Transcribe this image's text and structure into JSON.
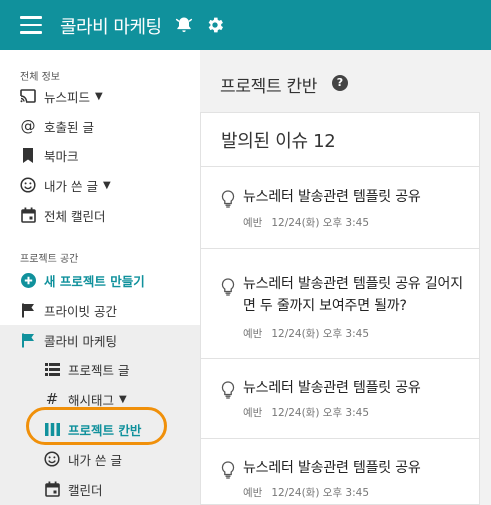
{
  "header": {
    "menu_icon": "hamburger-icon",
    "title": "콜라비 마케팅",
    "notification_icon": "bell-icon",
    "settings_icon": "gear-icon",
    "bg_color": "#10919c"
  },
  "sidebar": {
    "section_all": "전체 정보",
    "newsfeed": "뉴스피드",
    "mentions": "호출된 글",
    "bookmarks": "북마크",
    "my_posts": "내가 쓴 글",
    "all_calendar": "전체 캘린더",
    "section_projects": "프로젝트 공간",
    "new_project": "새 프로젝트 만들기",
    "private_space": "프라이빗 공간",
    "project_name": "콜라비 마케팅",
    "sub_project_posts": "프로젝트 글",
    "sub_hashtags": "해시태그",
    "sub_kanban": "프로젝트 칸반",
    "sub_my_posts": "내가 쓴 글",
    "sub_calendar": "캘린더"
  },
  "main": {
    "page_title": "프로젝트 칸반",
    "column_title": "발의된 이슈 12",
    "cards": [
      {
        "title": "뉴스레터 발송관련 템플릿 공유",
        "author": "예반",
        "date": "12/24(화) 오후 3:45"
      },
      {
        "title": "뉴스레터 발송관련 템플릿 공유 길어지면 두 줄까지 보여주면 될까?",
        "author": "예반",
        "date": "12/24(화) 오후 3:45"
      },
      {
        "title": "뉴스레터 발송관련 템플릿 공유",
        "author": "예반",
        "date": "12/24(화) 오후 3:45"
      },
      {
        "title": "뉴스레터 발송관련 템플릿 공유",
        "author": "예반",
        "date": "12/24(화) 오후 3:45"
      }
    ]
  },
  "colors": {
    "accent": "#10919c",
    "highlight_ring": "#f0900a"
  }
}
